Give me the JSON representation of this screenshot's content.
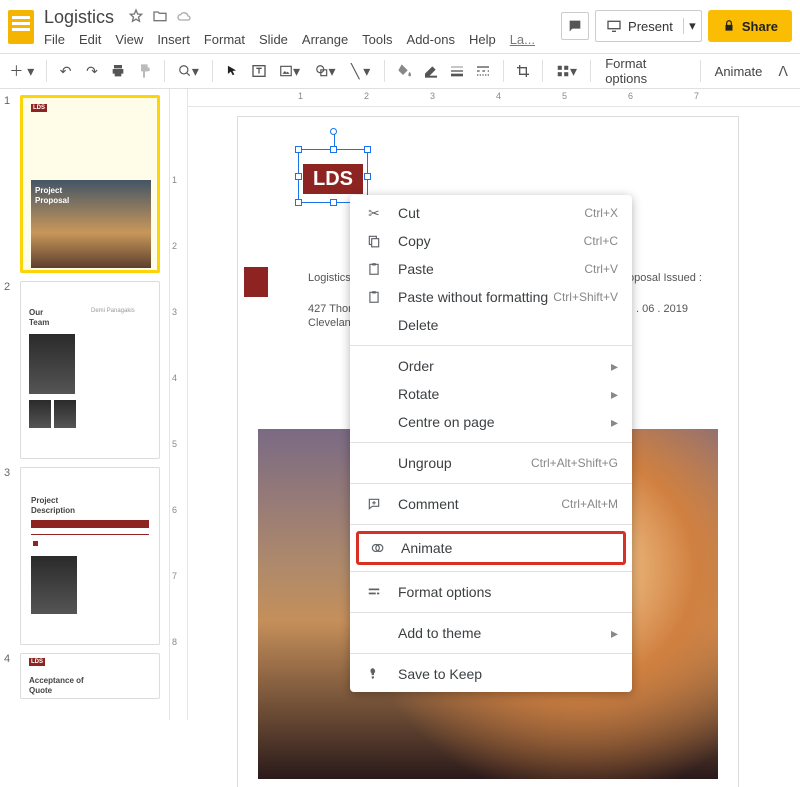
{
  "doc": {
    "title": "Logistics"
  },
  "menus": {
    "file": "File",
    "edit": "Edit",
    "view": "View",
    "insert": "Insert",
    "format": "Format",
    "slide": "Slide",
    "arrange": "Arrange",
    "tools": "Tools",
    "addons": "Add-ons",
    "help": "Help",
    "last": "La..."
  },
  "actions": {
    "present": "Present",
    "share": "Share",
    "format_options": "Format options",
    "animate": "Animate"
  },
  "ruler_h": [
    "1",
    "2",
    "3",
    "4",
    "5",
    "6",
    "7"
  ],
  "ruler_v": [
    "1",
    "2",
    "3",
    "4",
    "5",
    "6",
    "7",
    "8"
  ],
  "slides": {
    "s1": {
      "lds": "LDS",
      "p_title": "Project",
      "p_sub": "Proposal"
    },
    "s2": {
      "h1": "Our",
      "h2": "Team",
      "h3": "Demi Panagakis"
    },
    "s3": {
      "h1": "Project",
      "h2": "Description",
      "bar": "Project Description"
    },
    "s4": {
      "lds": "LDS",
      "h1": "Acceptance of",
      "h2": "Quote"
    }
  },
  "slide_main": {
    "lds": "LDS",
    "line1a": "Logistics De",
    "line1b": "oposal Issued :",
    "line2a": "427 Thompso",
    "line2b": ". 06 . 2019",
    "line3": "Cleveland , O"
  },
  "ctx": {
    "cut": "Cut",
    "cut_sc": "Ctrl+X",
    "copy": "Copy",
    "copy_sc": "Ctrl+C",
    "paste": "Paste",
    "paste_sc": "Ctrl+V",
    "paste_wf": "Paste without formatting",
    "paste_wf_sc": "Ctrl+Shift+V",
    "delete": "Delete",
    "order": "Order",
    "rotate": "Rotate",
    "centre": "Centre on page",
    "ungroup": "Ungroup",
    "ungroup_sc": "Ctrl+Alt+Shift+G",
    "comment": "Comment",
    "comment_sc": "Ctrl+Alt+M",
    "animate": "Animate",
    "format_options": "Format options",
    "add_theme": "Add to theme",
    "save_keep": "Save to Keep"
  }
}
